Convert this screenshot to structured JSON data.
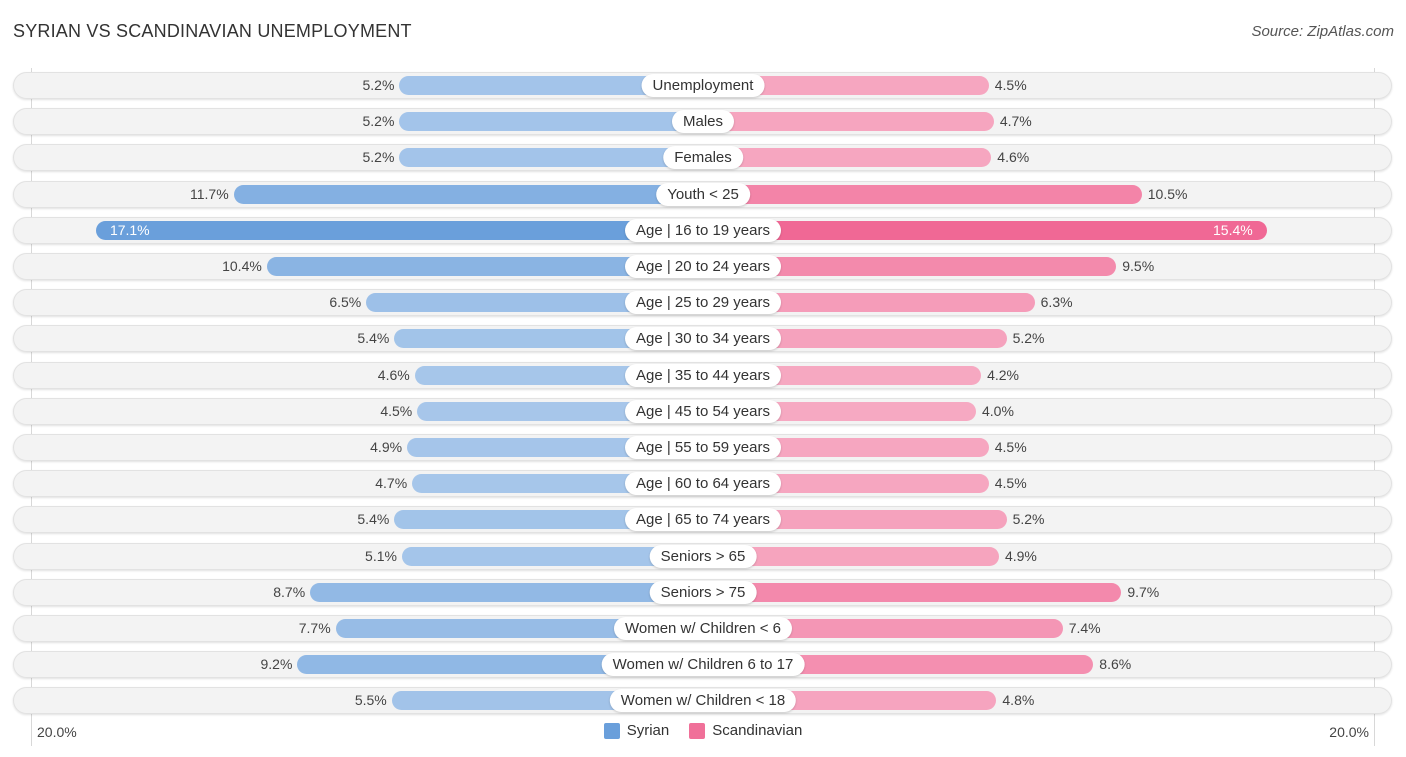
{
  "title": "SYRIAN VS SCANDINAVIAN UNEMPLOYMENT",
  "source": "Source: ZipAtlas.com",
  "colors": {
    "syrian": "#6a9fdb",
    "syrian_light": "#a7c6ea",
    "scandinavian": "#f07099",
    "scandinavian_light": "#f5a7c1"
  },
  "chart_data": {
    "type": "bar",
    "orientation": "diverging-horizontal",
    "title": "SYRIAN VS SCANDINAVIAN UNEMPLOYMENT",
    "categories": [
      "Unemployment",
      "Males",
      "Females",
      "Youth < 25",
      "Age | 16 to 19 years",
      "Age | 20 to 24 years",
      "Age | 25 to 29 years",
      "Age | 30 to 34 years",
      "Age | 35 to 44 years",
      "Age | 45 to 54 years",
      "Age | 55 to 59 years",
      "Age | 60 to 64 years",
      "Age | 65 to 74 years",
      "Seniors > 65",
      "Seniors > 75",
      "Women w/ Children < 6",
      "Women w/ Children 6 to 17",
      "Women w/ Children < 18"
    ],
    "series": [
      {
        "name": "Syrian",
        "side": "left",
        "values": [
          5.2,
          5.2,
          5.2,
          11.7,
          17.1,
          10.4,
          6.5,
          5.4,
          4.6,
          4.5,
          4.9,
          4.7,
          5.4,
          5.1,
          8.7,
          7.7,
          9.2,
          5.5
        ],
        "labels": [
          "5.2%",
          "5.2%",
          "5.2%",
          "11.7%",
          "17.1%",
          "10.4%",
          "6.5%",
          "5.4%",
          "4.6%",
          "4.5%",
          "4.9%",
          "4.7%",
          "5.4%",
          "5.1%",
          "8.7%",
          "7.7%",
          "9.2%",
          "5.5%"
        ]
      },
      {
        "name": "Scandinavian",
        "side": "right",
        "values": [
          4.5,
          4.7,
          4.6,
          10.5,
          15.4,
          9.5,
          6.3,
          5.2,
          4.2,
          4.0,
          4.5,
          4.5,
          5.2,
          4.9,
          9.7,
          7.4,
          8.6,
          4.8
        ],
        "labels": [
          "4.5%",
          "4.7%",
          "4.6%",
          "10.5%",
          "15.4%",
          "9.5%",
          "6.3%",
          "5.2%",
          "4.2%",
          "4.0%",
          "4.5%",
          "4.5%",
          "5.2%",
          "4.9%",
          "9.7%",
          "7.4%",
          "8.6%",
          "4.8%"
        ]
      }
    ],
    "axis": {
      "min_label": "20.0%",
      "max_label": "20.0%",
      "range": [
        -20,
        20
      ]
    },
    "legend": {
      "position": "bottom-center",
      "entries": [
        "Syrian",
        "Scandinavian"
      ]
    },
    "xlabel": "",
    "ylabel": ""
  }
}
